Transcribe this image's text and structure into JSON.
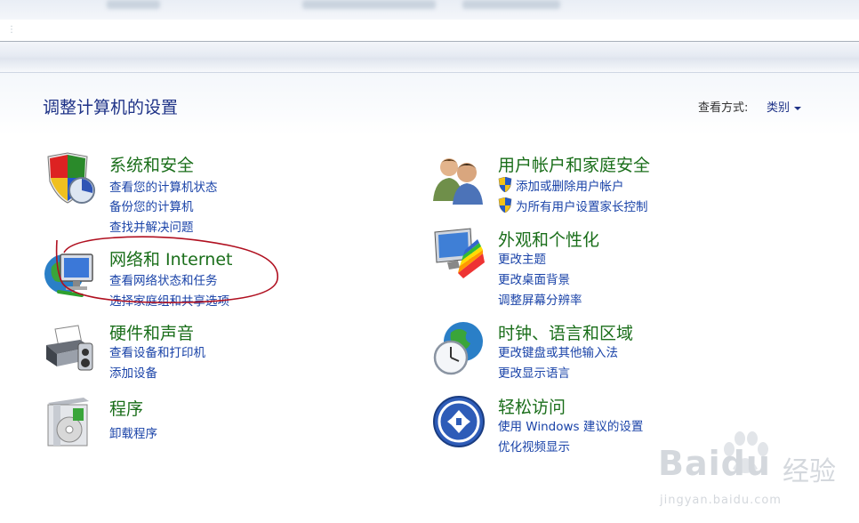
{
  "header": {
    "title": "调整计算机的设置",
    "view_by_label": "查看方式:",
    "view_by_value": "类别"
  },
  "categories": [
    {
      "id": "system",
      "title": "系统和安全",
      "icon": "shield-chart-icon",
      "links": [
        "查看您的计算机状态",
        "备份您的计算机",
        "查找并解决问题"
      ]
    },
    {
      "id": "network",
      "title": "网络和 Internet",
      "icon": "globe-network-icon",
      "links": [
        "查看网络状态和任务",
        "选择家庭组和共享选项"
      ]
    },
    {
      "id": "hardware",
      "title": "硬件和声音",
      "icon": "printer-icon",
      "links": [
        "查看设备和打印机",
        "添加设备"
      ]
    },
    {
      "id": "programs",
      "title": "程序",
      "icon": "program-box-icon",
      "links": [
        "卸载程序"
      ]
    },
    {
      "id": "users",
      "title": "用户帐户和家庭安全",
      "icon": "users-icon",
      "links": [
        "添加或删除用户帐户",
        "为所有用户设置家长控制"
      ]
    },
    {
      "id": "appearance",
      "title": "外观和个性化",
      "icon": "monitor-palette-icon",
      "links": [
        "更改主题",
        "更改桌面背景",
        "调整屏幕分辨率"
      ]
    },
    {
      "id": "clock",
      "title": "时钟、语言和区域",
      "icon": "globe-clock-icon",
      "links": [
        "更改键盘或其他输入法",
        "更改显示语言"
      ]
    },
    {
      "id": "ease",
      "title": "轻松访问",
      "icon": "ease-of-access-icon",
      "links": [
        "使用 Windows 建议的设置",
        "优化视频显示"
      ]
    }
  ],
  "watermark": {
    "brand": "Baidu",
    "brand_cn": "经验",
    "url": "jingyan.baidu.com"
  },
  "colors": {
    "title_blue": "#1e3287",
    "category_green": "#1a6e1a",
    "link_blue": "#1a43a8",
    "annotation_red": "#b01020"
  }
}
